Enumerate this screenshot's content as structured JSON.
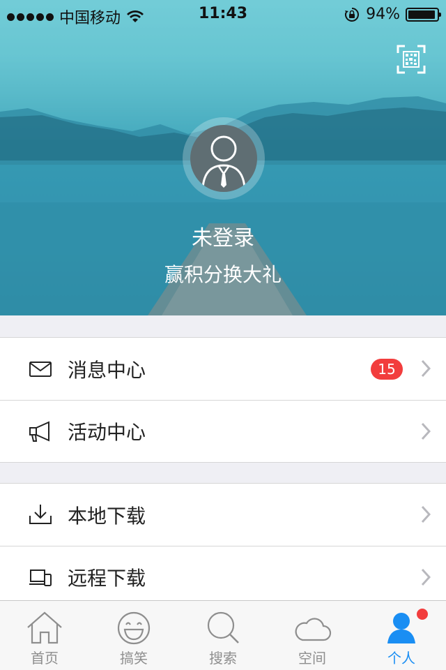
{
  "status_bar": {
    "carrier": "中国移动",
    "time": "11:43",
    "battery_text": "94%",
    "battery_level": 0.94
  },
  "header": {
    "qr_icon": "qr-code-icon",
    "login_status": "未登录",
    "points_text": "赢积分换大礼"
  },
  "menu_group1": [
    {
      "label": "消息中心",
      "icon": "envelope-icon",
      "badge": "15"
    },
    {
      "label": "活动中心",
      "icon": "megaphone-icon"
    }
  ],
  "menu_group2": [
    {
      "label": "本地下载",
      "icon": "download-icon"
    },
    {
      "label": "远程下载",
      "icon": "devices-icon"
    }
  ],
  "tabbar": [
    {
      "label": "首页",
      "icon": "home-icon"
    },
    {
      "label": "搞笑",
      "icon": "smile-icon"
    },
    {
      "label": "搜索",
      "icon": "search-icon"
    },
    {
      "label": "空间",
      "icon": "cloud-icon"
    },
    {
      "label": "个人",
      "icon": "person-icon",
      "active": true
    }
  ],
  "colors": {
    "accent": "#1a8ef3",
    "badge": "#f23d3d"
  }
}
